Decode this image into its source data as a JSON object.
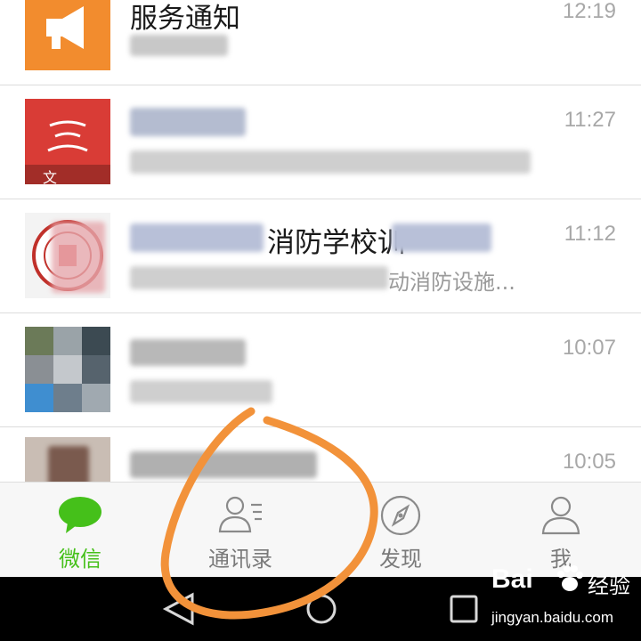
{
  "chats": [
    {
      "title": "服务通知",
      "time": "12:19",
      "preview": ""
    },
    {
      "title": "",
      "time": "11:27",
      "preview": "",
      "avatar_caption": "文"
    },
    {
      "title": "消防学校训",
      "time": "11:12",
      "preview": "动消防设施..."
    },
    {
      "title": "",
      "time": "10:07",
      "preview": ""
    },
    {
      "title": "",
      "time": "10:05",
      "preview": ""
    }
  ],
  "tabs": [
    {
      "label": "微信",
      "icon": "chat-bubble-icon",
      "active": true
    },
    {
      "label": "通讯录",
      "icon": "contacts-icon",
      "active": false
    },
    {
      "label": "发现",
      "icon": "compass-icon",
      "active": false
    },
    {
      "label": "我",
      "icon": "person-icon",
      "active": false
    }
  ],
  "nav": {
    "buttons": [
      "back-icon",
      "home-icon",
      "recents-icon"
    ]
  },
  "watermark": {
    "brand": "Bai",
    "brand_suffix": "经验",
    "url": "jingyan.baidu.com"
  },
  "colors": {
    "accent_green": "#45c01a",
    "notice_orange": "#f28c2e",
    "annotation_orange": "#f2923a",
    "time_gray": "#a8a8a8"
  }
}
